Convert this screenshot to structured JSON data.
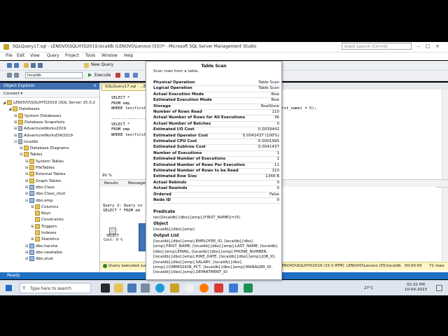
{
  "window": {
    "title": "SQLQuery17.sql - LENOVO\\SQLHYD2019.localdb (LENOVO\\Lenovo (55))* - Microsoft SQL Server Management Studio",
    "quick_launch_placeholder": "Quick Launch (Ctrl+Q)"
  },
  "menu": [
    "File",
    "Edit",
    "View",
    "Query",
    "Project",
    "Tools",
    "Window",
    "Help"
  ],
  "toolbar": {
    "new_query": "New Query",
    "database": "localdb",
    "execute": "Execute"
  },
  "object_explorer": {
    "title": "Object Explorer",
    "connect": "Connect ▾",
    "items": [
      {
        "label": "LENOVO\\SQLHYD2019 (SQL Server 15.0.2",
        "level": 0,
        "expander": "◢",
        "icon": "server"
      },
      {
        "label": "Databases",
        "level": 1,
        "expander": "◢",
        "icon": "folder"
      },
      {
        "label": "System Databases",
        "level": 2,
        "expander": "⊞",
        "icon": "folder"
      },
      {
        "label": "Database Snapshots",
        "level": 2,
        "expander": "⊞",
        "icon": "folder"
      },
      {
        "label": "AdventureWorks2019",
        "level": 2,
        "expander": "⊞",
        "icon": "db"
      },
      {
        "label": "AdventureWorksDW2019",
        "level": 2,
        "expander": "⊞",
        "icon": "db"
      },
      {
        "label": "localdb",
        "level": 2,
        "expander": "⊟",
        "icon": "db"
      },
      {
        "label": "Database Diagrams",
        "level": 3,
        "expander": "⊞",
        "icon": "folder"
      },
      {
        "label": "Tables",
        "level": 3,
        "expander": "⊟",
        "icon": "folder"
      },
      {
        "label": "System Tables",
        "level": 4,
        "expander": "⊞",
        "icon": "folder"
      },
      {
        "label": "FileTables",
        "level": 4,
        "expander": "⊞",
        "icon": "folder"
      },
      {
        "label": "External Tables",
        "level": 4,
        "expander": "⊞",
        "icon": "folder"
      },
      {
        "label": "Graph Tables",
        "level": 4,
        "expander": "⊞",
        "icon": "folder"
      },
      {
        "label": "dbo.Class",
        "level": 4,
        "expander": "⊞",
        "icon": "table"
      },
      {
        "label": "dbo.Class_stud",
        "level": 4,
        "expander": "⊞",
        "icon": "table"
      },
      {
        "label": "dbo.emp",
        "level": 4,
        "expander": "⊟",
        "icon": "table"
      },
      {
        "label": "Columns",
        "level": 5,
        "expander": "⊞",
        "icon": "folder"
      },
      {
        "label": "Keys",
        "level": 5,
        "expander": "",
        "icon": "folder"
      },
      {
        "label": "Constraints",
        "level": 5,
        "expander": "",
        "icon": "folder"
      },
      {
        "label": "Triggers",
        "level": 5,
        "expander": "⊞",
        "icon": "folder"
      },
      {
        "label": "Indexes",
        "level": 5,
        "expander": "",
        "icon": "folder"
      },
      {
        "label": "Statistics",
        "level": 5,
        "expander": "⊞",
        "icon": "folder"
      },
      {
        "label": "dbo.harsha",
        "level": 4,
        "expander": "⊞",
        "icon": "table"
      },
      {
        "label": "dbo.newtable",
        "level": 4,
        "expander": "⊞",
        "icon": "table"
      },
      {
        "label": "dbo.stud",
        "level": 4,
        "expander": "⊞",
        "icon": "table"
      }
    ]
  },
  "editor": {
    "tab": "SQLQuery17.sql - ...ENOVO\\",
    "code_lines": [
      "SELECT *",
      "FROM emp",
      "WHERE len(first_n",
      "",
      "------------------",
      "SELECT *",
      "FROM emp",
      "WHERE len(first_n"
    ],
    "right_fragment": "irst_name) = 5);",
    "zoom": "90 %",
    "results_tab": "Results",
    "messages_tab": "Messages",
    "plan_lines": [
      "Query 2: Query co",
      "SELECT * FROM em"
    ],
    "plan_select_label": "SELECT",
    "plan_cost_label": "Cost: 0 %",
    "status_text": "Query executed successfully.",
    "status_server": "LENOVO\\SQLHYD2019 (15.0 RTM)",
    "status_user": "LENOVO\\Lenovo (55)",
    "status_db": "localdb",
    "status_time": "00:00:00",
    "status_rows": "72 rows"
  },
  "tooltip": {
    "title": "Table Scan",
    "description": "Scan rows from a table.",
    "properties": [
      {
        "k": "Physical Operation",
        "v": "Table Scan"
      },
      {
        "k": "Logical Operation",
        "v": "Table Scan"
      },
      {
        "k": "Actual Execution Mode",
        "v": "Row"
      },
      {
        "k": "Estimated Execution Mode",
        "v": "Row"
      },
      {
        "k": "Storage",
        "v": "RowStore"
      },
      {
        "k": "Number of Rows Read",
        "v": "110"
      },
      {
        "k": "Actual Number of Rows for All Executions",
        "v": "36"
      },
      {
        "k": "Actual Number of Batches",
        "v": "0"
      },
      {
        "k": "Estimated I/O Cost",
        "v": "0.0039442"
      },
      {
        "k": "Estimated Operator Cost",
        "v": "0.0041437 (100%)"
      },
      {
        "k": "Estimated CPU Cost",
        "v": "0.0001995"
      },
      {
        "k": "Estimated Subtree Cost",
        "v": "0.0041437"
      },
      {
        "k": "Number of Executions",
        "v": "1"
      },
      {
        "k": "Estimated Number of Executions",
        "v": "1"
      },
      {
        "k": "Estimated Number of Rows Per Execution",
        "v": "11"
      },
      {
        "k": "Estimated Number of Rows to be Read",
        "v": "110"
      },
      {
        "k": "Estimated Row Size",
        "v": "1348 B"
      },
      {
        "k": "Actual Rebinds",
        "v": "0"
      },
      {
        "k": "Actual Rewinds",
        "v": "0"
      },
      {
        "k": "Ordered",
        "v": "False"
      },
      {
        "k": "Node ID",
        "v": "0"
      }
    ],
    "predicate_label": "Predicate",
    "predicate": "len([localdb].[dbo].[emp].[FIRST_NAME])=(5)",
    "object_label": "Object",
    "object": "[localdb].[dbo].[emp]",
    "output_label": "Output List",
    "output": "[localdb].[dbo].[emp].EMPLOYEE_ID, [localdb].[dbo].[emp].FIRST_NAME, [localdb].[dbo].[emp].LAST_NAME, [localdb].[dbo].[emp].EMAIL, [localdb].[dbo].[emp].PHONE_NUMBER, [localdb].[dbo].[emp].HIRE_DATE, [localdb].[dbo].[emp].JOB_ID, [localdb].[dbo].[emp].SALARY, [localdb].[dbo].[emp].COMMISSION_PCT, [localdb].[dbo].[emp].MANAGER_ID, [localdb].[dbo].[emp].DEPARTMENT_ID"
  },
  "status": {
    "ready": "Ready"
  },
  "taskbar": {
    "search_placeholder": "Type here to search",
    "weather": "27°C",
    "time": "02:32 PM",
    "date": "10-04-2023"
  },
  "colors": {
    "accent": "#1f6fc4",
    "explorer_header": "#3f6fb0",
    "tab_active": "#fff7c6"
  }
}
